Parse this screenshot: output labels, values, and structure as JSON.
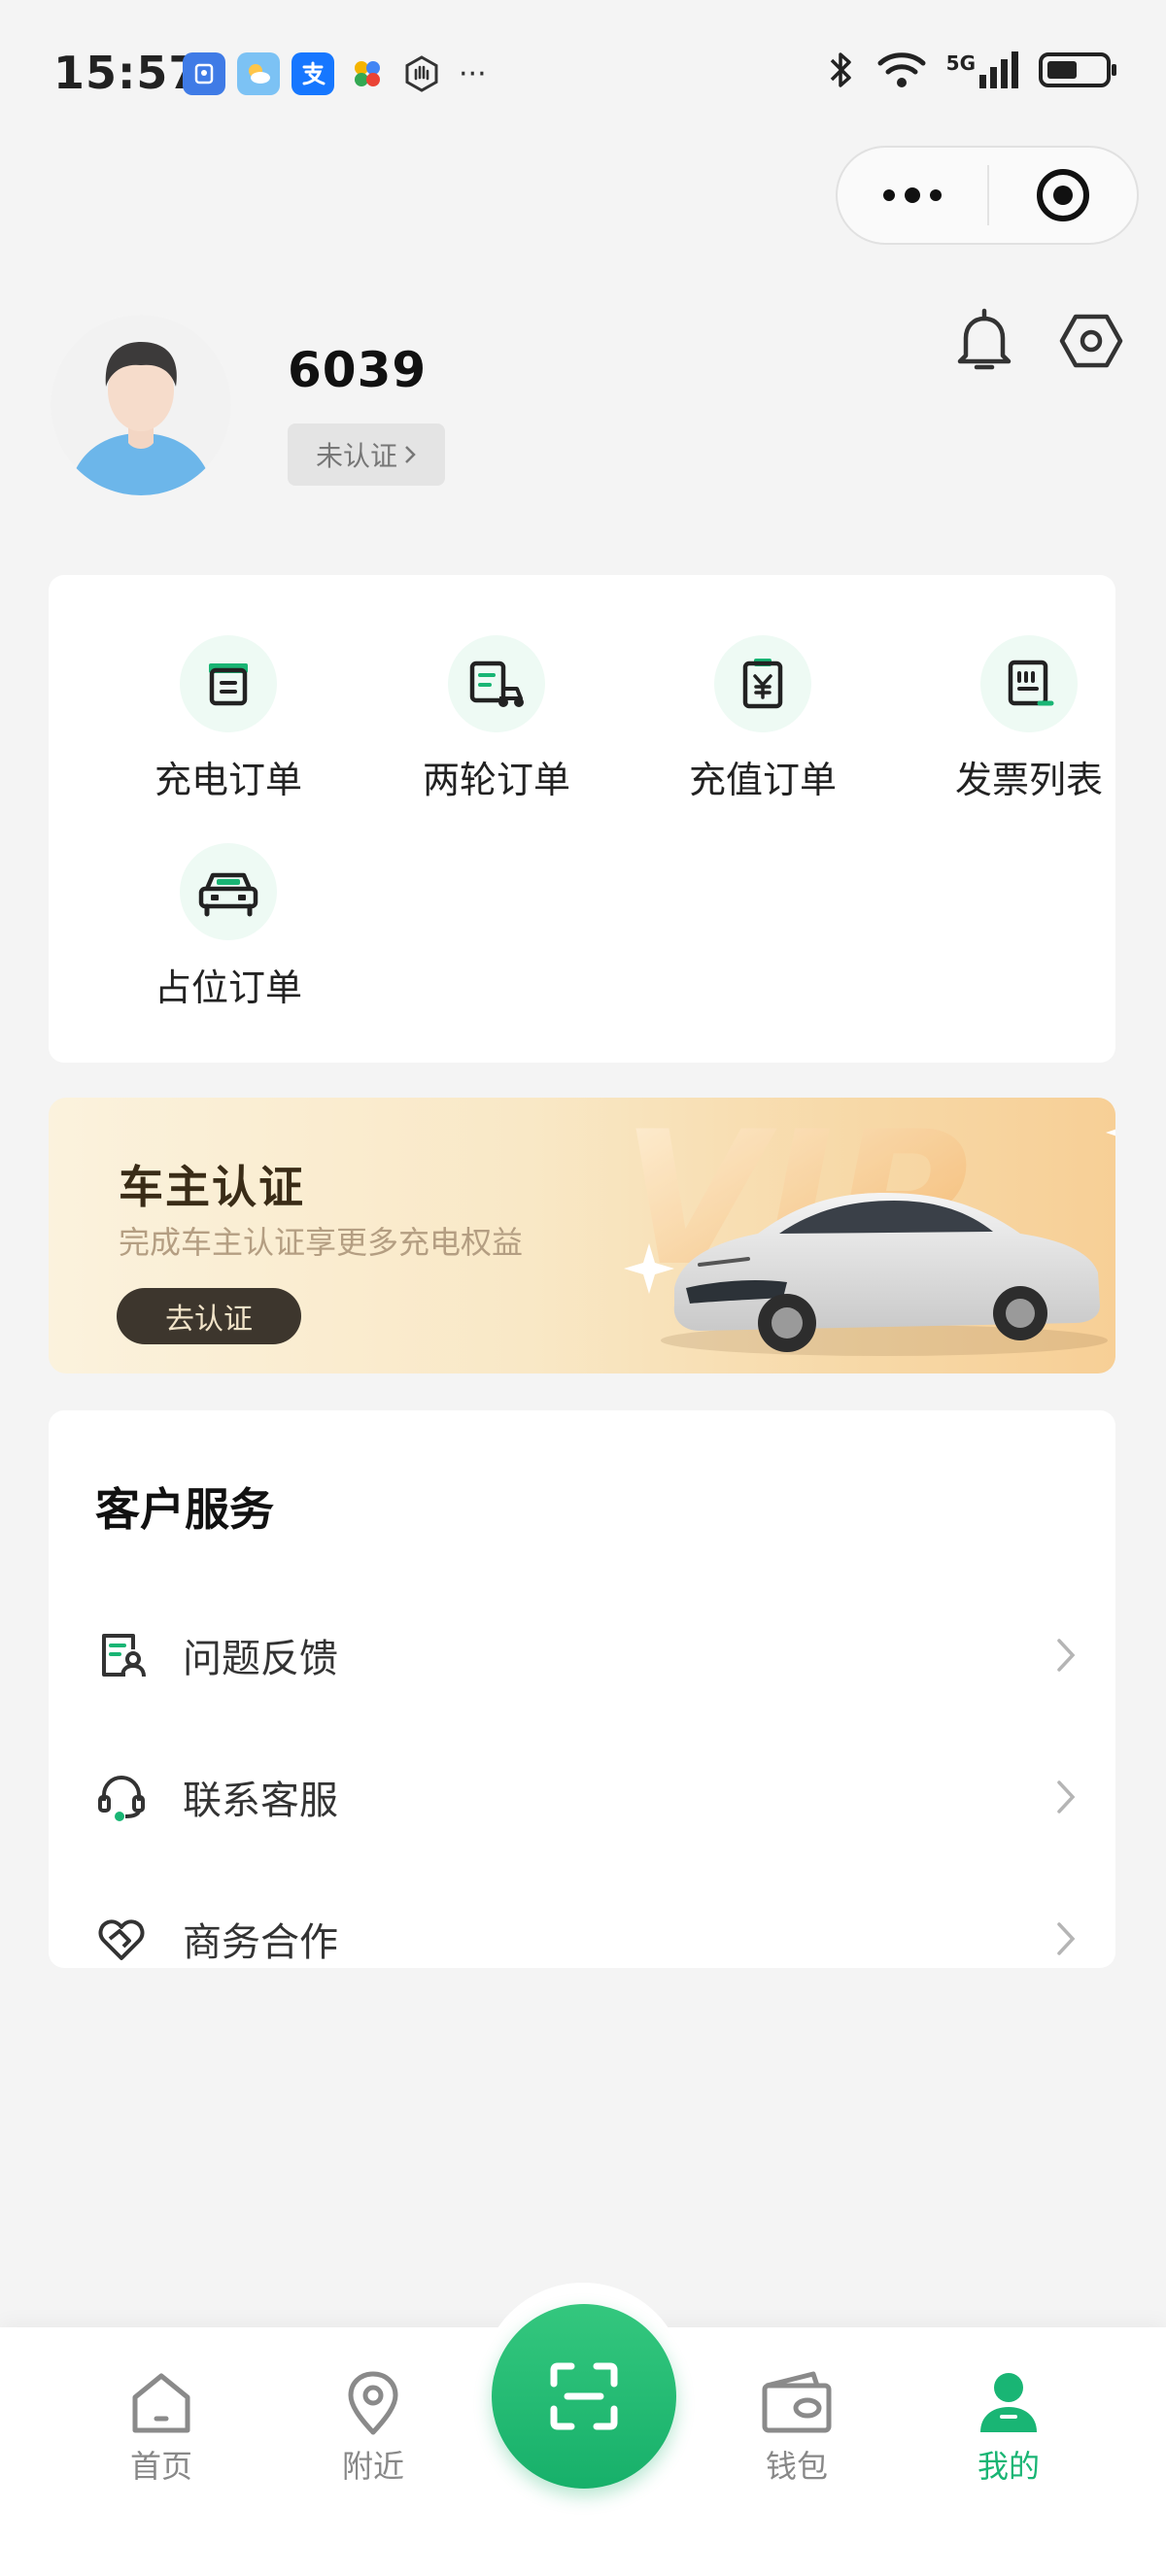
{
  "status_bar": {
    "time": "15:57",
    "network": "5G",
    "more_label": "···"
  },
  "profile": {
    "username": "6039",
    "auth_status": "未认证"
  },
  "orders": [
    {
      "label": "充电订单",
      "icon": "charging-order-icon"
    },
    {
      "label": "两轮订单",
      "icon": "two-wheeler-order-icon"
    },
    {
      "label": "充值订单",
      "icon": "recharge-order-icon"
    },
    {
      "label": "发票列表",
      "icon": "invoice-list-icon"
    },
    {
      "label": "占位订单",
      "icon": "parking-order-icon"
    }
  ],
  "vip_banner": {
    "title": "车主认证",
    "subtitle": "完成车主认证享更多充电权益",
    "button": "去认证",
    "art_text": "VIP"
  },
  "service": {
    "title": "客户服务",
    "items": [
      {
        "label": "问题反馈",
        "icon": "feedback-icon"
      },
      {
        "label": "联系客服",
        "icon": "headset-icon"
      },
      {
        "label": "商务合作",
        "icon": "handshake-heart-icon"
      }
    ]
  },
  "tabbar": {
    "items": [
      {
        "label": "首页",
        "icon": "home-icon",
        "active": false
      },
      {
        "label": "附近",
        "icon": "location-icon",
        "active": false
      },
      {
        "label": "钱包",
        "icon": "wallet-icon",
        "active": false
      },
      {
        "label": "我的",
        "icon": "user-icon",
        "active": true
      }
    ],
    "scan_icon": "scan-icon"
  },
  "colors": {
    "accent": "#19b574",
    "icon_bg": "#eefaf4",
    "background": "#f4f4f4",
    "vip_button": "#3d362d"
  }
}
